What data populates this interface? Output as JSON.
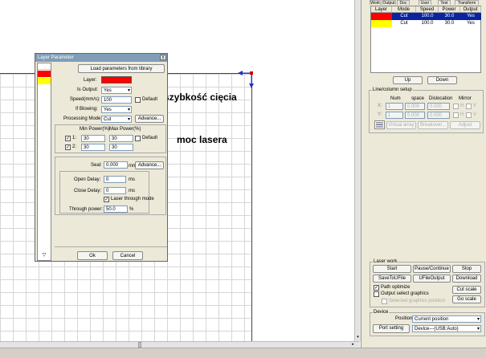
{
  "annotations": {
    "cutting_speed": "szybkość cięcia",
    "laser_power": "moc lasera"
  },
  "tabs": [
    "Work",
    "Output",
    "Doc",
    "User",
    "Test",
    "Transform"
  ],
  "layer_table": {
    "headers": [
      "Layer",
      "Mode",
      "Speed",
      "Power",
      "Output"
    ],
    "rows": [
      {
        "color": "#ff0000",
        "mode": "Cut",
        "speed": "100.0",
        "power": "30.0",
        "output": "Yes",
        "selected": true
      },
      {
        "color": "#ffff00",
        "mode": "Cut",
        "speed": "100.0",
        "power": "30.0",
        "output": "Yes",
        "selected": false
      }
    ]
  },
  "table_buttons": {
    "up": "Up",
    "down": "Down"
  },
  "line_column": {
    "title": "Line/column setup",
    "headers": {
      "num": "Num",
      "space": "space",
      "dislocation": "Dislocation",
      "mirror": "Mirror"
    },
    "x_label": "X:",
    "y_label": "Y:",
    "x_num": "1",
    "x_space": "0.000",
    "x_dis": "0.000",
    "y_num": "1",
    "y_space": "0.000",
    "y_dis": "0.000",
    "h": "H",
    "v": "V",
    "virtual_array": "Virtual array",
    "breakover": "Breakover...",
    "adjust": "Adjust"
  },
  "laser_work": {
    "title": "Laser work",
    "start": "Start",
    "pause": "Pause/Continue",
    "stop": "Stop",
    "save_to_ufile": "SaveToUFile",
    "ufile_output": "UFileOutput",
    "download": "Download",
    "path_optimize": "Path optimize",
    "output_select": "Output select graphics",
    "selected_position": "Selected graphics position",
    "cut_scale": "Cut scale",
    "go_scale": "Go scale"
  },
  "device": {
    "title": "Device",
    "position_label": "Position:",
    "position_value": "Current position",
    "port_setting": "Port setting",
    "device_value": "Device---(USB:Auto)"
  },
  "dialog": {
    "title": "Layer Parameter",
    "close": "x",
    "load_library": "Load parameters from library",
    "layer_label": "Layer:",
    "layer_color": "#ff0000",
    "is_output_label": "Is Output:",
    "is_output_value": "Yes",
    "speed_label": "Speed(mm/s):",
    "speed_value": "100",
    "default_label": "Default",
    "if_blowing_label": "If Blowing:",
    "if_blowing_value": "Yes",
    "processing_mode_label": "Processing Mode:",
    "processing_mode_value": "Cut",
    "advance": "Advance...",
    "min_power_header": "Min Power(%)",
    "max_power_header": "Max Power(%)",
    "row1_label": "1:",
    "row1_min": "30",
    "row1_max": "30",
    "row2_label": "2:",
    "row2_min": "30",
    "row2_max": "30",
    "seal_label": "Seal:",
    "seal_value": "0.000",
    "seal_unit": "mm",
    "open_delay_label": "Open Delay:",
    "open_delay_value": "0",
    "open_delay_unit": "ms",
    "close_delay_label": "Close Delay:",
    "close_delay_value": "0",
    "close_delay_unit": "ms",
    "laser_through_mode": "Laser through mode",
    "through_power_label": "Through power:",
    "through_power_value": "50.0",
    "through_power_unit": "%",
    "ok": "Ok",
    "cancel": "Cancel",
    "layer_colors": [
      "#ffffff",
      "#ff0000",
      "#ffff00"
    ]
  }
}
